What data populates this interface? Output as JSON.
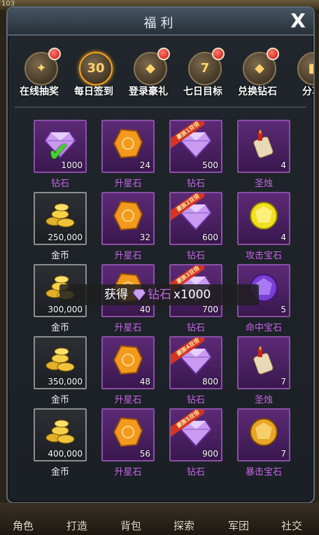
{
  "background": {
    "top_number": "103"
  },
  "panel": {
    "title": "福利",
    "close_label": "X"
  },
  "tabs": [
    {
      "label": "在线抽奖",
      "icon": "lottery-ticket-icon",
      "glyph": "✦",
      "badge": true,
      "active": false
    },
    {
      "label": "每日签到",
      "icon": "calendar-30-icon",
      "glyph": "30",
      "badge": false,
      "active": true
    },
    {
      "label": "登录豪礼",
      "icon": "treasure-chest-icon",
      "glyph": "◆",
      "badge": true,
      "active": false
    },
    {
      "label": "七日目标",
      "icon": "seven-day-icon",
      "glyph": "7",
      "badge": true,
      "active": false
    },
    {
      "label": "兑换钻石",
      "icon": "purple-diamond-icon",
      "glyph": "◆",
      "badge": true,
      "active": false
    },
    {
      "label": "分享",
      "icon": "gift-box-icon",
      "glyph": "■",
      "badge": false,
      "active": false
    }
  ],
  "rewards": [
    [
      {
        "name": "钻石",
        "qty": "1000",
        "type": "diamond",
        "claimed": true,
        "frame": "purple"
      },
      {
        "name": "升星石",
        "qty": "24",
        "type": "orange",
        "frame": "purple"
      },
      {
        "name": "钻石",
        "qty": "500",
        "type": "diamond",
        "ribbon": "豪族1双倍",
        "frame": "purple"
      },
      {
        "name": "圣烛",
        "qty": "4",
        "type": "scroll",
        "frame": "purple"
      }
    ],
    [
      {
        "name": "金币",
        "qty": "250,000",
        "type": "coins",
        "frame": "gray",
        "name_white": true
      },
      {
        "name": "升星石",
        "qty": "32",
        "type": "orange",
        "frame": "purple"
      },
      {
        "name": "钻石",
        "qty": "600",
        "type": "diamond",
        "ribbon": "豪族2双倍",
        "frame": "purple"
      },
      {
        "name": "攻击宝石",
        "qty": "4",
        "type": "yellow",
        "frame": "purple"
      }
    ],
    [
      {
        "name": "金币",
        "qty": "300,000",
        "type": "coins",
        "frame": "gray",
        "name_white": true
      },
      {
        "name": "升星石",
        "qty": "40",
        "type": "orange",
        "frame": "purple"
      },
      {
        "name": "钻石",
        "qty": "700",
        "type": "diamond",
        "ribbon": "豪族3双倍",
        "frame": "purple"
      },
      {
        "name": "命中宝石",
        "qty": "5",
        "type": "violet",
        "frame": "purple"
      }
    ],
    [
      {
        "name": "金币",
        "qty": "350,000",
        "type": "coins",
        "frame": "gray",
        "name_white": true
      },
      {
        "name": "升星石",
        "qty": "48",
        "type": "orange",
        "frame": "purple"
      },
      {
        "name": "钻石",
        "qty": "800",
        "type": "diamond",
        "ribbon": "豪族4双倍",
        "frame": "purple"
      },
      {
        "name": "圣烛",
        "qty": "7",
        "type": "scroll",
        "frame": "purple"
      }
    ],
    [
      {
        "name": "金币",
        "qty": "400,000",
        "type": "coins",
        "frame": "gray",
        "name_white": true
      },
      {
        "name": "升星石",
        "qty": "56",
        "type": "orange",
        "frame": "purple"
      },
      {
        "name": "钻石",
        "qty": "900",
        "type": "diamond",
        "ribbon": "豪族5双倍",
        "frame": "purple"
      },
      {
        "name": "暴击宝石",
        "qty": "7",
        "type": "amber",
        "frame": "purple"
      }
    ]
  ],
  "toast": {
    "prefix": "获得",
    "item": "钻石",
    "amount": "x1000"
  },
  "bottom_nav": [
    "角色",
    "打造",
    "背包",
    "探索",
    "军团",
    "社交"
  ],
  "colors": {
    "accent_purple": "#c763e8",
    "panel_bg": "#1e2329"
  }
}
